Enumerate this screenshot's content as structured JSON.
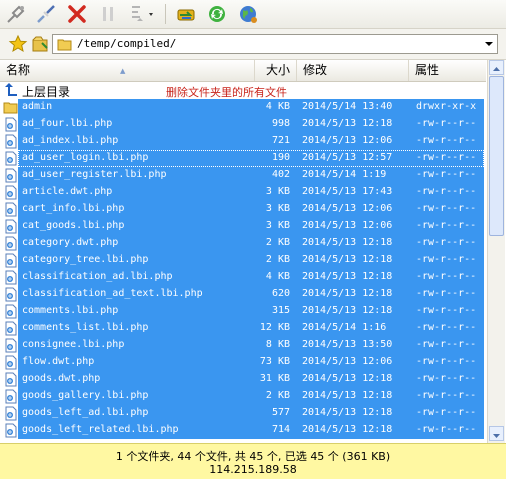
{
  "toolbar": {
    "buttons": [
      "connect-icon",
      "disconnect-icon",
      "stop-icon",
      "pause-icon",
      "queue-icon",
      "transfer-icon",
      "refresh-icon",
      "globe-icon"
    ]
  },
  "address": {
    "path": "/temp/compiled/"
  },
  "columns": {
    "name": "名称",
    "size": "大小",
    "modified": "修改",
    "attributes": "属性"
  },
  "parent_dir": {
    "label": "上层目录",
    "annotation": "删除文件夹里的所有文件"
  },
  "files": [
    {
      "name": "admin",
      "size": "4 KB",
      "date": "2014/5/14 13:40",
      "attr": "drwxr-xr-x",
      "type": "folder"
    },
    {
      "name": "ad_four.lbi.php",
      "size": "998",
      "date": "2014/5/13 12:18",
      "attr": "-rw-r--r--",
      "type": "file"
    },
    {
      "name": "ad_index.lbi.php",
      "size": "721",
      "date": "2014/5/13 12:06",
      "attr": "-rw-r--r--",
      "type": "file"
    },
    {
      "name": "ad_user_login.lbi.php",
      "size": "190",
      "date": "2014/5/13 12:57",
      "attr": "-rw-r--r--",
      "type": "file"
    },
    {
      "name": "ad_user_register.lbi.php",
      "size": "402",
      "date": "2014/5/14 1:19",
      "attr": "-rw-r--r--",
      "type": "file"
    },
    {
      "name": "article.dwt.php",
      "size": "3 KB",
      "date": "2014/5/13 17:43",
      "attr": "-rw-r--r--",
      "type": "file"
    },
    {
      "name": "cart_info.lbi.php",
      "size": "3 KB",
      "date": "2014/5/13 12:06",
      "attr": "-rw-r--r--",
      "type": "file"
    },
    {
      "name": "cat_goods.lbi.php",
      "size": "3 KB",
      "date": "2014/5/13 12:06",
      "attr": "-rw-r--r--",
      "type": "file"
    },
    {
      "name": "category.dwt.php",
      "size": "2 KB",
      "date": "2014/5/13 12:18",
      "attr": "-rw-r--r--",
      "type": "file"
    },
    {
      "name": "category_tree.lbi.php",
      "size": "2 KB",
      "date": "2014/5/13 12:18",
      "attr": "-rw-r--r--",
      "type": "file"
    },
    {
      "name": "classification_ad.lbi.php",
      "size": "4 KB",
      "date": "2014/5/13 12:18",
      "attr": "-rw-r--r--",
      "type": "file"
    },
    {
      "name": "classification_ad_text.lbi.php",
      "size": "620",
      "date": "2014/5/13 12:18",
      "attr": "-rw-r--r--",
      "type": "file"
    },
    {
      "name": "comments.lbi.php",
      "size": "315",
      "date": "2014/5/13 12:18",
      "attr": "-rw-r--r--",
      "type": "file"
    },
    {
      "name": "comments_list.lbi.php",
      "size": "12 KB",
      "date": "2014/5/14 1:16",
      "attr": "-rw-r--r--",
      "type": "file"
    },
    {
      "name": "consignee.lbi.php",
      "size": "8 KB",
      "date": "2014/5/13 13:50",
      "attr": "-rw-r--r--",
      "type": "file"
    },
    {
      "name": "flow.dwt.php",
      "size": "73 KB",
      "date": "2014/5/13 12:06",
      "attr": "-rw-r--r--",
      "type": "file"
    },
    {
      "name": "goods.dwt.php",
      "size": "31 KB",
      "date": "2014/5/13 12:18",
      "attr": "-rw-r--r--",
      "type": "file"
    },
    {
      "name": "goods_gallery.lbi.php",
      "size": "2 KB",
      "date": "2014/5/13 12:18",
      "attr": "-rw-r--r--",
      "type": "file"
    },
    {
      "name": "goods_left_ad.lbi.php",
      "size": "577",
      "date": "2014/5/13 12:18",
      "attr": "-rw-r--r--",
      "type": "file"
    },
    {
      "name": "goods_left_related.lbi.php",
      "size": "714",
      "date": "2014/5/13 12:18",
      "attr": "-rw-r--r--",
      "type": "file"
    }
  ],
  "status": {
    "summary": "1 个文件夹, 44 个文件, 共 45 个, 已选 45 个 (361 KB)",
    "ip": "114.215.189.58"
  },
  "colors": {
    "selection": "#3a96f0",
    "status_bg": "#fff8a2",
    "annotation": "#c8241b"
  }
}
